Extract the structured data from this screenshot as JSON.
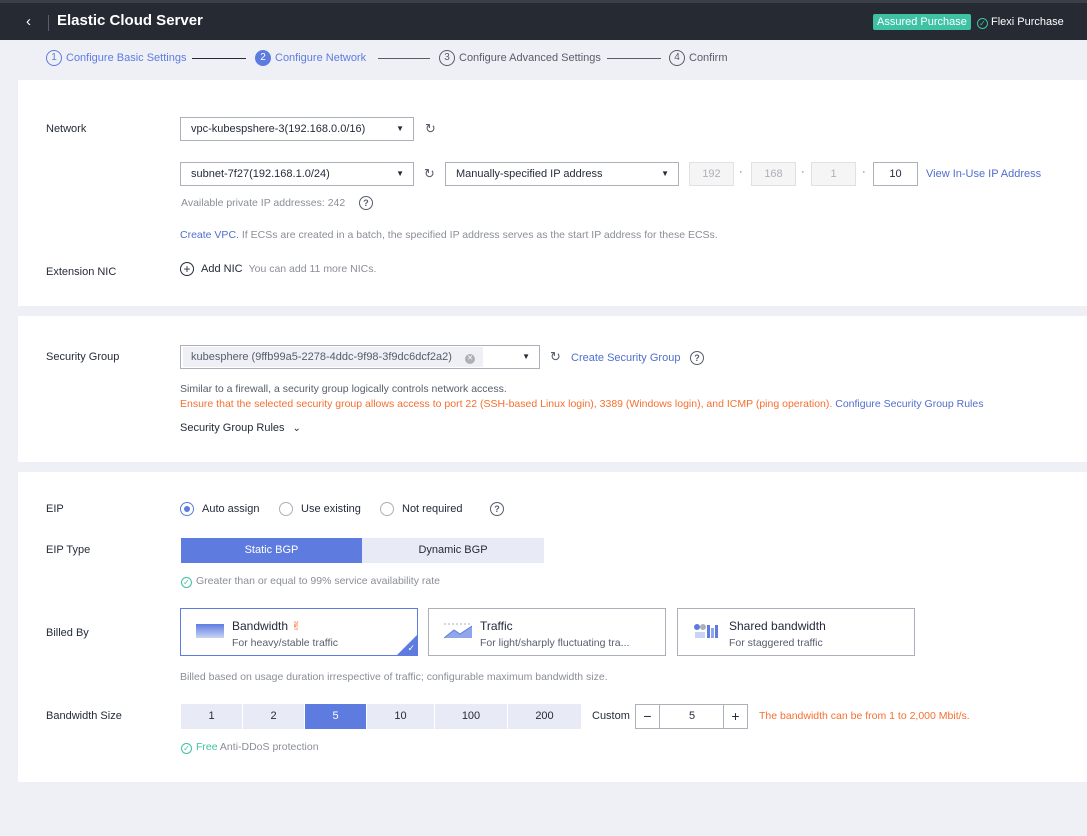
{
  "header": {
    "back_icon": "chevron-left-icon",
    "title": "Elastic Cloud Server",
    "assured_purchase": "Assured Purchase",
    "flexi_purchase": "Flexi Purchase"
  },
  "steps": [
    {
      "num": "1",
      "label": "Configure Basic Settings",
      "state": "done"
    },
    {
      "num": "2",
      "label": "Configure Network",
      "state": "active"
    },
    {
      "num": "3",
      "label": "Configure Advanced Settings",
      "state": "todo"
    },
    {
      "num": "4",
      "label": "Confirm",
      "state": "todo"
    }
  ],
  "network": {
    "label": "Network",
    "vpc_value": "vpc-kubespshere-3(192.168.0.0/16)",
    "subnet_value": "subnet-7f27(192.168.1.0/24)",
    "ip_mode_value": "Manually-specified IP address",
    "ip_octets": [
      "192",
      "168",
      "1",
      "10"
    ],
    "view_in_use": "View In-Use IP Address",
    "available_private": "Available private IP addresses: 242",
    "create_vpc": "Create VPC.",
    "batch_note": " If ECSs are created in a batch, the specified IP address serves as the start IP address for these ECSs.",
    "extension_label": "Extension NIC",
    "add_nic": "Add NIC",
    "add_nic_hint": "You can add 11 more NICs."
  },
  "security": {
    "label": "Security Group",
    "value": "kubesphere (9ffb99a5-2278-4ddc-9f98-3f9dc6dcf2a2)",
    "create_link": "Create Security Group",
    "desc": "Similar to a firewall, a security group logically controls network access.",
    "warning": "Ensure that the selected security group allows access to port 22 (SSH-based Linux login), 3389 (Windows login), and ICMP (ping operation).",
    "configure_rules": "Configure Security Group Rules",
    "rules_toggle": "Security Group Rules"
  },
  "eip": {
    "label": "EIP",
    "options": [
      "Auto assign",
      "Use existing",
      "Not required"
    ],
    "selected": "Auto assign",
    "type_label": "EIP Type",
    "types": [
      "Static BGP",
      "Dynamic BGP"
    ],
    "selected_type": "Static BGP",
    "availability": "Greater than or equal to 99% service availability rate",
    "billed_label": "Billed By",
    "billing_cards": [
      {
        "title": "Bandwidth",
        "sub": "For heavy/stable traffic",
        "selected": true
      },
      {
        "title": "Traffic",
        "sub": "For light/sharply fluctuating tra...",
        "selected": false
      },
      {
        "title": "Shared bandwidth",
        "sub": "For staggered traffic",
        "selected": false
      }
    ],
    "billing_note": "Billed based on usage duration irrespective of traffic; configurable maximum bandwidth size.",
    "bw_label": "Bandwidth Size",
    "bw_options": [
      "1",
      "2",
      "5",
      "10",
      "100",
      "200"
    ],
    "bw_selected": "5",
    "custom_label": "Custom",
    "custom_value": "5",
    "bw_range": "The bandwidth can be from 1 to 2,000 Mbit/s.",
    "free": "Free",
    "anti_ddos": " Anti-DDoS protection"
  },
  "colors": {
    "accent": "#5e7ce0",
    "header_bg": "#252a33",
    "assured_green": "#3fc1a4",
    "warning_orange": "#f66f30"
  }
}
